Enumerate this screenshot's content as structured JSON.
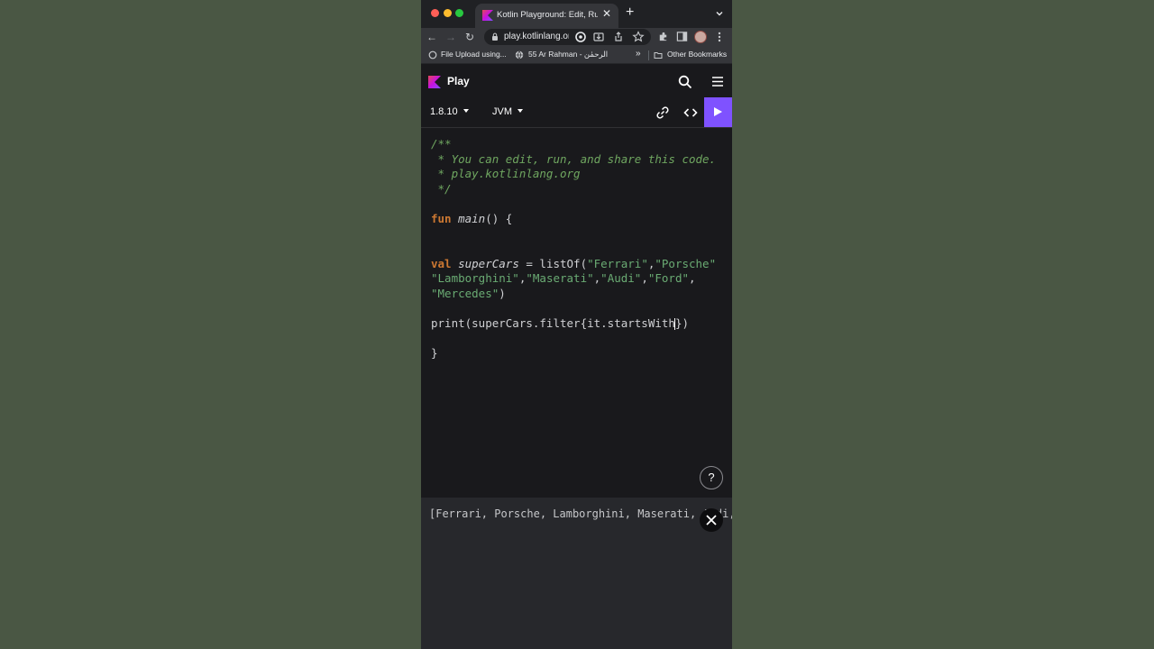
{
  "browser": {
    "tab": {
      "title": "Kotlin Playground: Edit, Run, Share Kotlin Code Online"
    },
    "address": {
      "url": "play.kotlinlang.org"
    },
    "bookmarks": [
      {
        "label": "File Upload using..."
      },
      {
        "label": "55 Ar Rahman - الرحمٰن"
      }
    ],
    "bookmarks_more": "»",
    "other_bookmarks": "Other Bookmarks"
  },
  "playground": {
    "brand": "Play",
    "version": "1.8.10",
    "target": "JVM"
  },
  "editor": {
    "comment": [
      "/**",
      " * You can edit, run, and share this code.",
      " * play.kotlinlang.org",
      " */"
    ],
    "kw_fun": "fun",
    "fn_main": "main",
    "main_tail": "() {",
    "kw_val": "val",
    "var_name": "superCars",
    "assign": " = listOf(",
    "strings": [
      "\"Ferrari\"",
      "\"Porsche\"",
      "\"Lamborghini\"",
      "\"Maserati\"",
      "\"Audi\"",
      "\"Ford\"",
      "\"Mercedes\""
    ],
    "comma": ",",
    "comma_space": ", ",
    "close_paren": ")",
    "print_head": "print(superCars.filter{it.startsWith",
    "print_tail": "})",
    "closing_brace": "}"
  },
  "help": {
    "label": "?"
  },
  "output": {
    "text": "[Ferrari, Porsche, Lamborghini, Maserati, Audi, Ford, Mercedes]"
  },
  "colors": {
    "accent": "#7f52ff",
    "editor_bg": "#19191c",
    "output_bg": "#27282c",
    "backdrop": "#4a5744"
  },
  "icons": {
    "tab_favicon": "kotlin-logo-icon",
    "search": "search-icon",
    "menu": "hamburger-menu-icon",
    "share": "link-icon",
    "code": "code-brackets-icon",
    "run": "play-icon",
    "close": "close-icon"
  }
}
